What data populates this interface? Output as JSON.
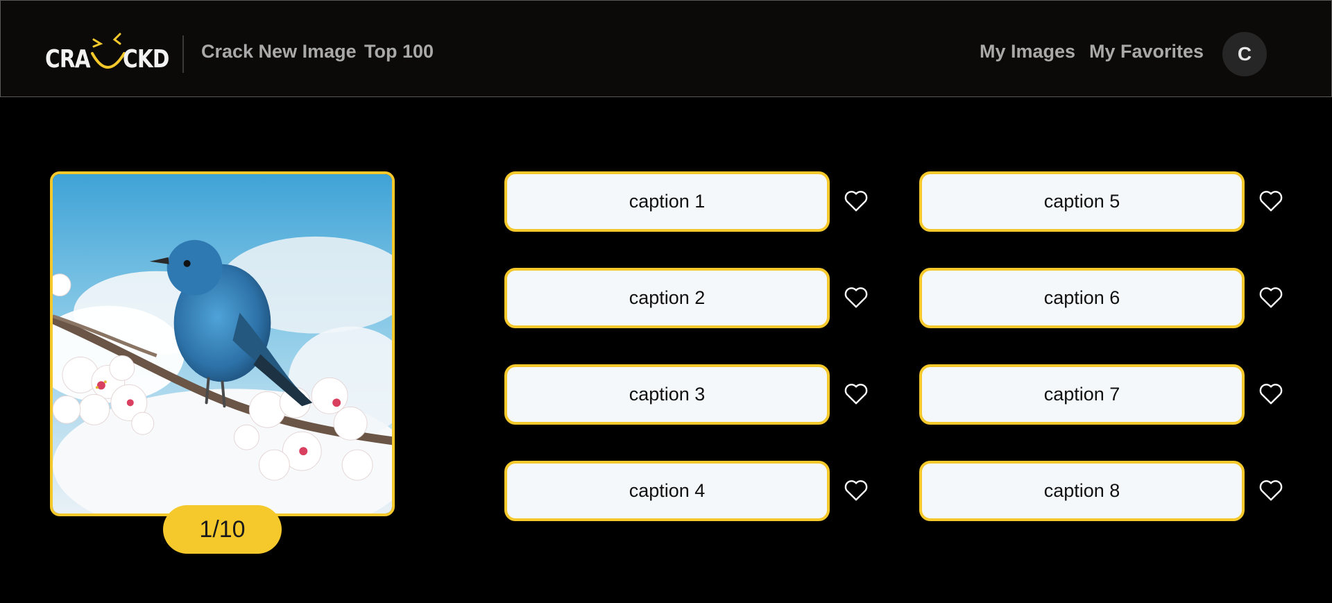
{
  "header": {
    "logo_left": "CRA",
    "logo_right": "CKD",
    "nav": {
      "crack_new_image": "Crack New Image",
      "top_100": "Top 100",
      "my_images": "My Images",
      "my_favorites": "My Favorites"
    },
    "avatar_initial": "C"
  },
  "image": {
    "counter": "1/10"
  },
  "captions": [
    "caption 1",
    "caption 2",
    "caption 3",
    "caption 4",
    "caption 5",
    "caption 6",
    "caption 7",
    "caption 8"
  ],
  "colors": {
    "accent": "#f5c92c",
    "header_bg": "#0b0a08",
    "page_bg": "#000000",
    "caption_bg": "#f4f8fb"
  },
  "icons": {
    "favorite": "heart-outline-icon"
  }
}
